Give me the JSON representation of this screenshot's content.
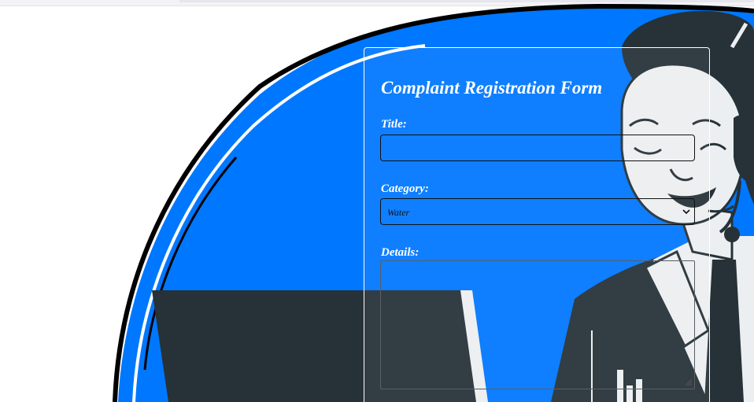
{
  "form": {
    "title": "Complaint Registration Form",
    "fields": {
      "title": {
        "label": "Title:",
        "value": ""
      },
      "category": {
        "label": "Category:",
        "selected": "Water"
      },
      "details": {
        "label": "Details:",
        "value": ""
      }
    }
  },
  "illustration": {
    "name": "support-agent-headset-illustration",
    "colors": {
      "background_blob": "#0077ff",
      "outline": "#000000",
      "dark_shapes": "#263238",
      "light_fill": "#eceff1",
      "page_background": "#ffffff"
    }
  },
  "icons": {
    "select": "chevron-down-icon",
    "textarea": "resize-handle-icon"
  }
}
